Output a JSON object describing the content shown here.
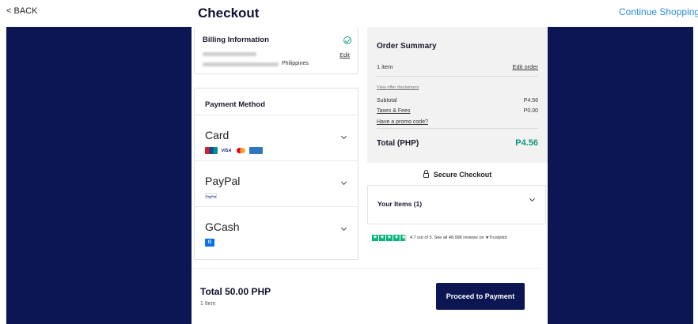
{
  "header": {
    "back_label": "< BACK",
    "title": "Checkout",
    "continue_label": "Continue Shopping"
  },
  "billing": {
    "title": "Billing Information",
    "country": "Philippines",
    "edit_label": "Edit",
    "status_icon": "check-circle-icon"
  },
  "payment": {
    "title": "Payment Method",
    "methods": [
      {
        "name": "Card",
        "logos": [
          "UnionPay",
          "VISA",
          "Mastercard",
          "American Express"
        ]
      },
      {
        "name": "PayPal",
        "logos": [
          "PayPal"
        ]
      },
      {
        "name": "GCash",
        "logos": [
          "G"
        ]
      }
    ]
  },
  "summary": {
    "title": "Order Summary",
    "items_count": "1 item",
    "edit_order_label": "Edit order",
    "disclaimer_label": "View offer disclaimers",
    "subtotal_label": "Subtotal",
    "subtotal_value": "P4.56",
    "taxes_label": "Taxes & Fees",
    "taxes_value": "P0.00",
    "promo_label": "Have a promo code?",
    "total_label": "Total (PHP)",
    "total_value": "P4.56"
  },
  "secure_label": "Secure Checkout",
  "your_items_label": "Your Items (1)",
  "trustpilot": {
    "rating_text": "4.7 out of 5. See all 48,998 reviews on ★Trustpilot",
    "rating": 4.7,
    "max": 5
  },
  "footer": {
    "total": "Total 50.00 PHP",
    "item_count": "1 Item",
    "proceed_label": "Proceed to Payment"
  },
  "colors": {
    "navy": "#0b1653",
    "teal": "#14967e",
    "link_blue": "#2a8fd6",
    "trustpilot_green": "#00b67a"
  }
}
